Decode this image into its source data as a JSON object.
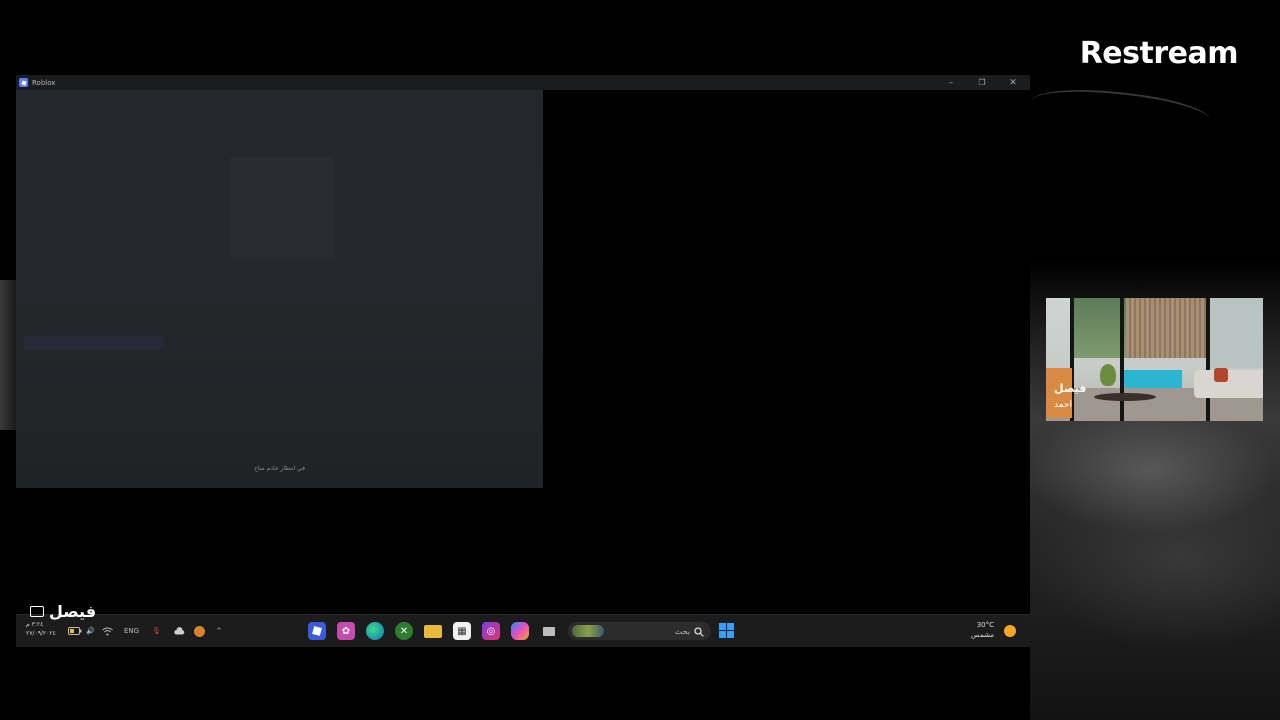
{
  "stream": {
    "brand": "Restream"
  },
  "window": {
    "title": "Roblox",
    "controls": {
      "minimize": "–",
      "restore": "❐",
      "close": "✕"
    },
    "status_text": "في انتظار خادم متاح"
  },
  "taskbar": {
    "clock_time": "٣:٢٤ م",
    "clock_date": "٢٧/٠٩/٢٠٢٤",
    "tray": {
      "language": "ENG"
    },
    "search_placeholder": "بحث",
    "weather": {
      "temp": "30°C",
      "condition": "مشمس"
    }
  },
  "overlay": {
    "chat_name": "فيصل",
    "cam_name": "فيصل",
    "cam_subname": "احمد"
  }
}
